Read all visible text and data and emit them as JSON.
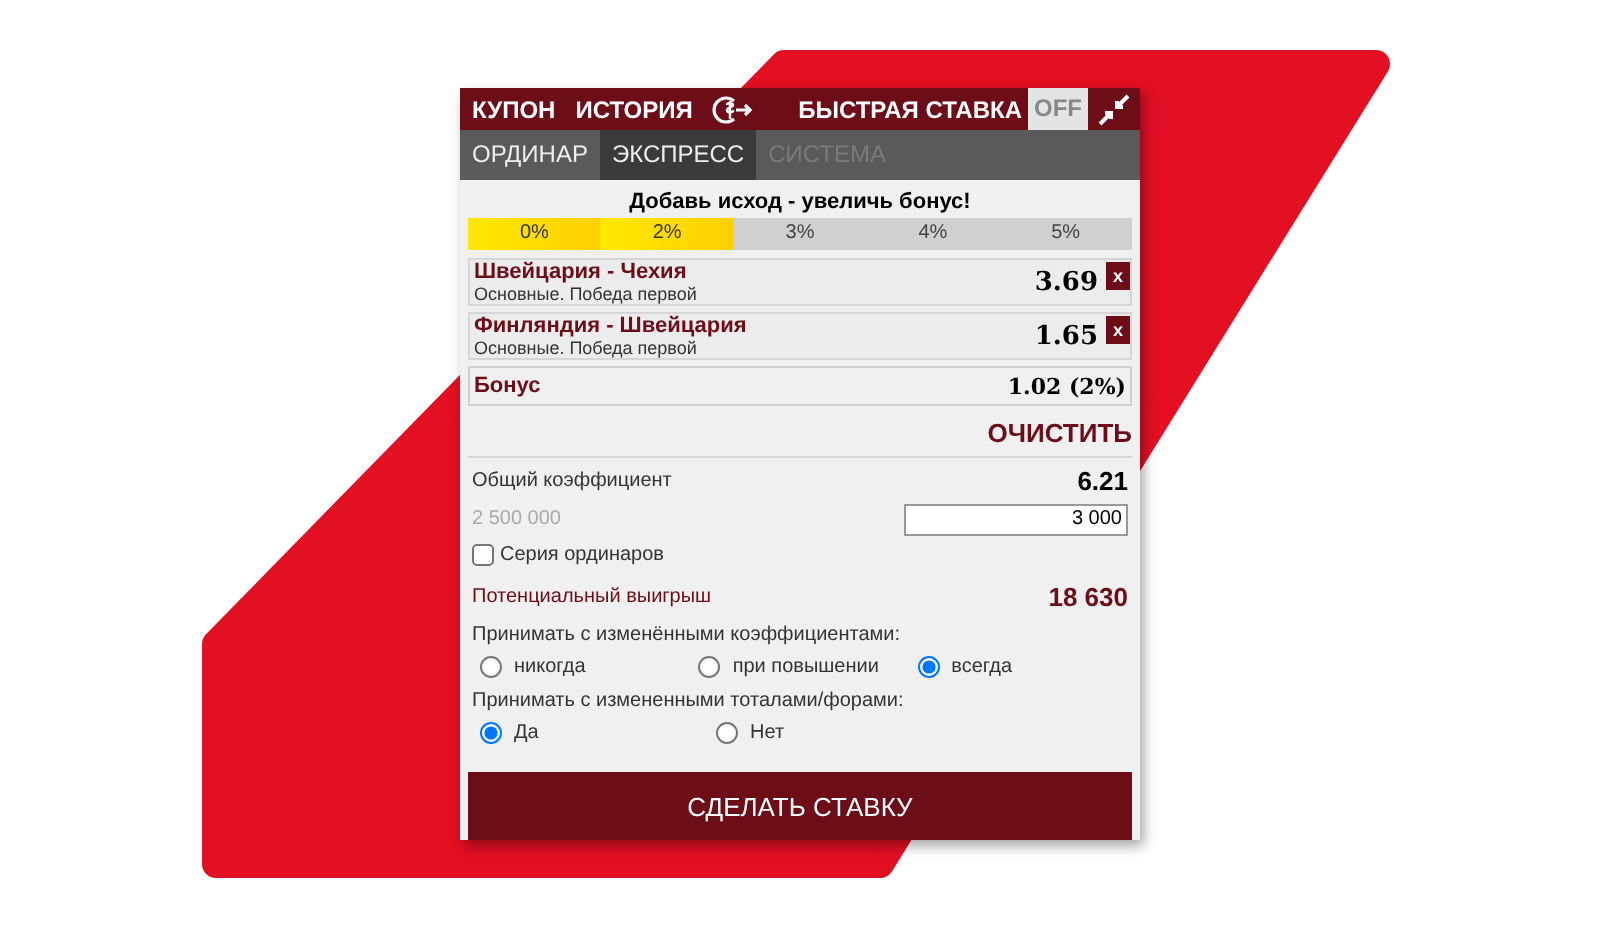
{
  "header": {
    "tabs": [
      {
        "label": "КУПОН"
      },
      {
        "label": "ИСТОРИЯ"
      }
    ],
    "quick_bet": {
      "label": "БЫСТРАЯ СТАВКА",
      "toggle": "OFF",
      "on": false
    }
  },
  "bet_types": [
    {
      "label": "ОРДИНАР",
      "selected": false,
      "disabled": false
    },
    {
      "label": "ЭКСПРЕСС",
      "selected": true,
      "disabled": false
    },
    {
      "label": "СИСТЕМА",
      "selected": false,
      "disabled": true
    }
  ],
  "bonus_hint": "Добавь исход - увеличь бонус!",
  "bonus_scale": [
    {
      "label": "0%",
      "reached": true
    },
    {
      "label": "2%",
      "reached": true
    },
    {
      "label": "3%",
      "reached": false
    },
    {
      "label": "4%",
      "reached": false
    },
    {
      "label": "5%",
      "reached": false
    }
  ],
  "selections": [
    {
      "event": "Швейцария - Чехия",
      "market": "Основные. Победа первой",
      "odds": "3.69",
      "remove": "x"
    },
    {
      "event": "Финляндия - Швейцария",
      "market": "Основные. Победа первой",
      "odds": "1.65",
      "remove": "x"
    }
  ],
  "bonus": {
    "label": "Бонус",
    "value": "1.02 (2%)"
  },
  "clear": "ОЧИСТИТЬ",
  "total_odds": {
    "label": "Общий коэффициент",
    "value": "6.21"
  },
  "max_stake": "2 500 000",
  "stake": {
    "value": "3 000"
  },
  "series": {
    "label": "Серия ординаров",
    "checked": false
  },
  "potential_win": {
    "label": "Потенциальный выигрыш",
    "value": "18 630"
  },
  "odds_change": {
    "label": "Принимать с изменёнными коэффициентами:",
    "options": [
      {
        "label": "никогда",
        "selected": false
      },
      {
        "label": "при повышении",
        "selected": false
      },
      {
        "label": "всегда",
        "selected": true
      }
    ]
  },
  "totals_change": {
    "label": "Принимать с измененными тоталами/форами:",
    "options": [
      {
        "label": "Да",
        "selected": true
      },
      {
        "label": "Нет",
        "selected": false
      }
    ]
  },
  "submit": "СДЕЛАТЬ СТАВКУ"
}
